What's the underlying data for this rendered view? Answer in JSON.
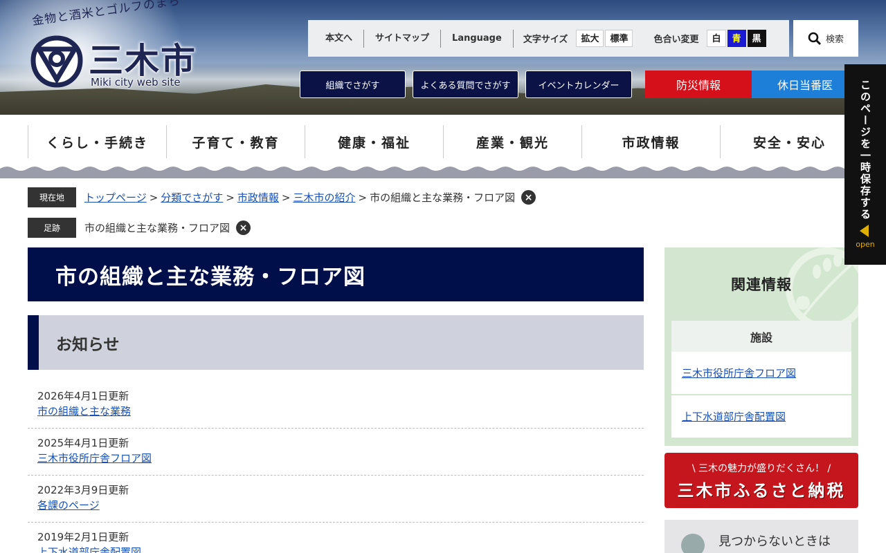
{
  "header": {
    "catchphrase": "金物と酒米とゴルフのまち",
    "city_name": "三木市",
    "subtitle": "Miki city web site",
    "utility": {
      "links": [
        "本文へ",
        "サイトマップ",
        "Language"
      ],
      "font_size_label": "文字サイズ",
      "font_size_buttons": [
        "拡大",
        "標準"
      ],
      "color_label": "色合い変更",
      "color_buttons": [
        "白",
        "青",
        "黒"
      ],
      "search_label": "検索"
    },
    "nav_buttons": [
      "組織でさがす",
      "よくある質問でさがす",
      "イベントカレンダー"
    ],
    "disaster_label": "防災情報",
    "holiday_label": "休日当番医"
  },
  "global_nav": [
    "くらし・手続き",
    "子育て・教育",
    "健康・福祉",
    "産業・観光",
    "市政情報",
    "安全・安心"
  ],
  "breadcrumb": {
    "current_label": "現在地",
    "items": [
      "トップページ",
      "分類でさがす",
      "市政情報",
      "三木市の紹介"
    ],
    "current": "市の組織と主な業務・フロア図",
    "history_label": "足跡",
    "history_item": "市の組織と主な業務・フロア図"
  },
  "main": {
    "page_title": "市の組織と主な業務・フロア図",
    "section_title": "お知らせ",
    "news": [
      {
        "date": "2026年4月1日更新",
        "title": "市の組織と主な業務"
      },
      {
        "date": "2025年4月1日更新",
        "title": "三木市役所庁舎フロア図"
      },
      {
        "date": "2022年3月9日更新",
        "title": "各課のページ"
      },
      {
        "date": "2019年2月1日更新",
        "title": "上下水道部庁舎配置図"
      }
    ]
  },
  "sidebar": {
    "related_title": "関連情報",
    "box_heading": "施設",
    "links": [
      "三木市役所庁舎フロア図",
      "上下水道部庁舎配置図"
    ],
    "banner_top": "\\ 三木の魅力が盛りだくさん！ /",
    "banner_main": "三木市ふるさと納税",
    "not_found": "見つからないときは"
  },
  "save_tab": {
    "text": "このページを一時保存する",
    "open": "open"
  },
  "colors": {
    "navy": "#000f4a",
    "disaster_red": "#d6101a",
    "holiday_blue": "#1e7fd8",
    "related_green": "#d3e7d0",
    "link_blue": "#1751b8"
  }
}
